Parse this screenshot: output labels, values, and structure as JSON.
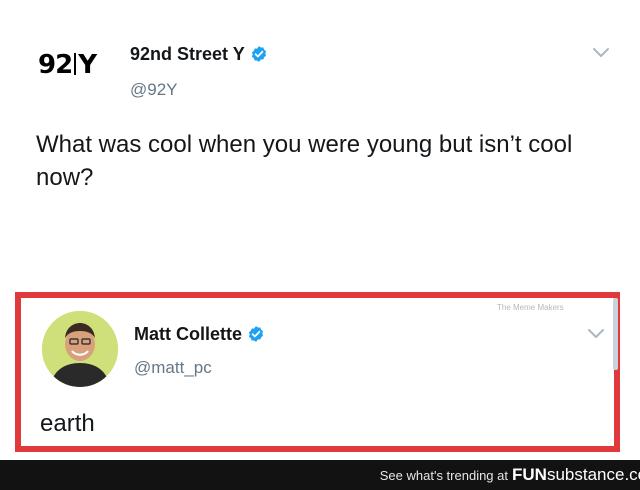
{
  "tweet": {
    "logo_text": "92Y",
    "name": "92nd Street Y",
    "handle": "@92Y",
    "text": "What was cool when you were young but isn’t cool now?"
  },
  "reply": {
    "name": "Matt Collette",
    "handle": "@matt_pc",
    "text": "earth",
    "watermark": "The Meme Makers"
  },
  "footer": {
    "text": "See what's trending at",
    "brand_bold": "FUN",
    "brand_rest": "substance.com"
  },
  "colors": {
    "verified": "#1da1f2",
    "highlight_border": "#e0393c",
    "footer_bg": "#121212"
  },
  "icons": [
    "verified-badge-icon",
    "chevron-down-icon"
  ]
}
